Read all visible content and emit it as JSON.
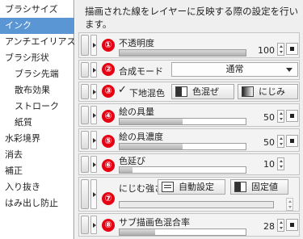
{
  "categories": [
    {
      "label": "ブラシサイズ",
      "sub": false,
      "selected": false
    },
    {
      "label": "インク",
      "sub": false,
      "selected": true
    },
    {
      "label": "アンチエイリアス",
      "sub": false,
      "selected": false
    },
    {
      "label": "ブラシ形状",
      "sub": false,
      "selected": false
    },
    {
      "label": "ブラシ先端",
      "sub": true,
      "selected": false
    },
    {
      "label": "散布効果",
      "sub": true,
      "selected": false
    },
    {
      "label": "ストローク",
      "sub": true,
      "selected": false
    },
    {
      "label": "紙質",
      "sub": true,
      "selected": false
    },
    {
      "label": "水彩境界",
      "sub": false,
      "selected": false
    },
    {
      "label": "消去",
      "sub": false,
      "selected": false
    },
    {
      "label": "補正",
      "sub": false,
      "selected": false
    },
    {
      "label": "入り抜き",
      "sub": false,
      "selected": false
    },
    {
      "label": "はみ出し防止",
      "sub": false,
      "selected": false
    }
  ],
  "description": "描画された線をレイヤーに反映する際の設定を行います。",
  "rows": {
    "opacity": {
      "num": "①",
      "label": "不透明度",
      "value": "100",
      "level": 1.0
    },
    "blend": {
      "num": "②",
      "label": "合成モード",
      "selected": "通常"
    },
    "underlying": {
      "num": "③",
      "check": "✓",
      "label": "下地混色",
      "btn1": "色混ぜ",
      "btn2": "にじみ"
    },
    "paint_amount": {
      "num": "④",
      "label": "絵の具量",
      "value": "50",
      "level": 0.5
    },
    "paint_density": {
      "num": "⑤",
      "label": "絵の具濃度",
      "value": "50",
      "level": 0.5
    },
    "color_stretch": {
      "num": "⑥",
      "label": "色延び",
      "value": "10",
      "level": 0.1
    },
    "blur_strength": {
      "num": "⑦",
      "label": "にじむ強さ",
      "btn1": "自動設定",
      "btn2": "固定値"
    },
    "sub_color_mix": {
      "num": "⑧",
      "label": "サブ描画色混合率",
      "value": "28",
      "level": 0.28
    }
  },
  "colors": {
    "selected": "#5a96d4",
    "badge": "#e60012",
    "panel": "#efefef"
  }
}
